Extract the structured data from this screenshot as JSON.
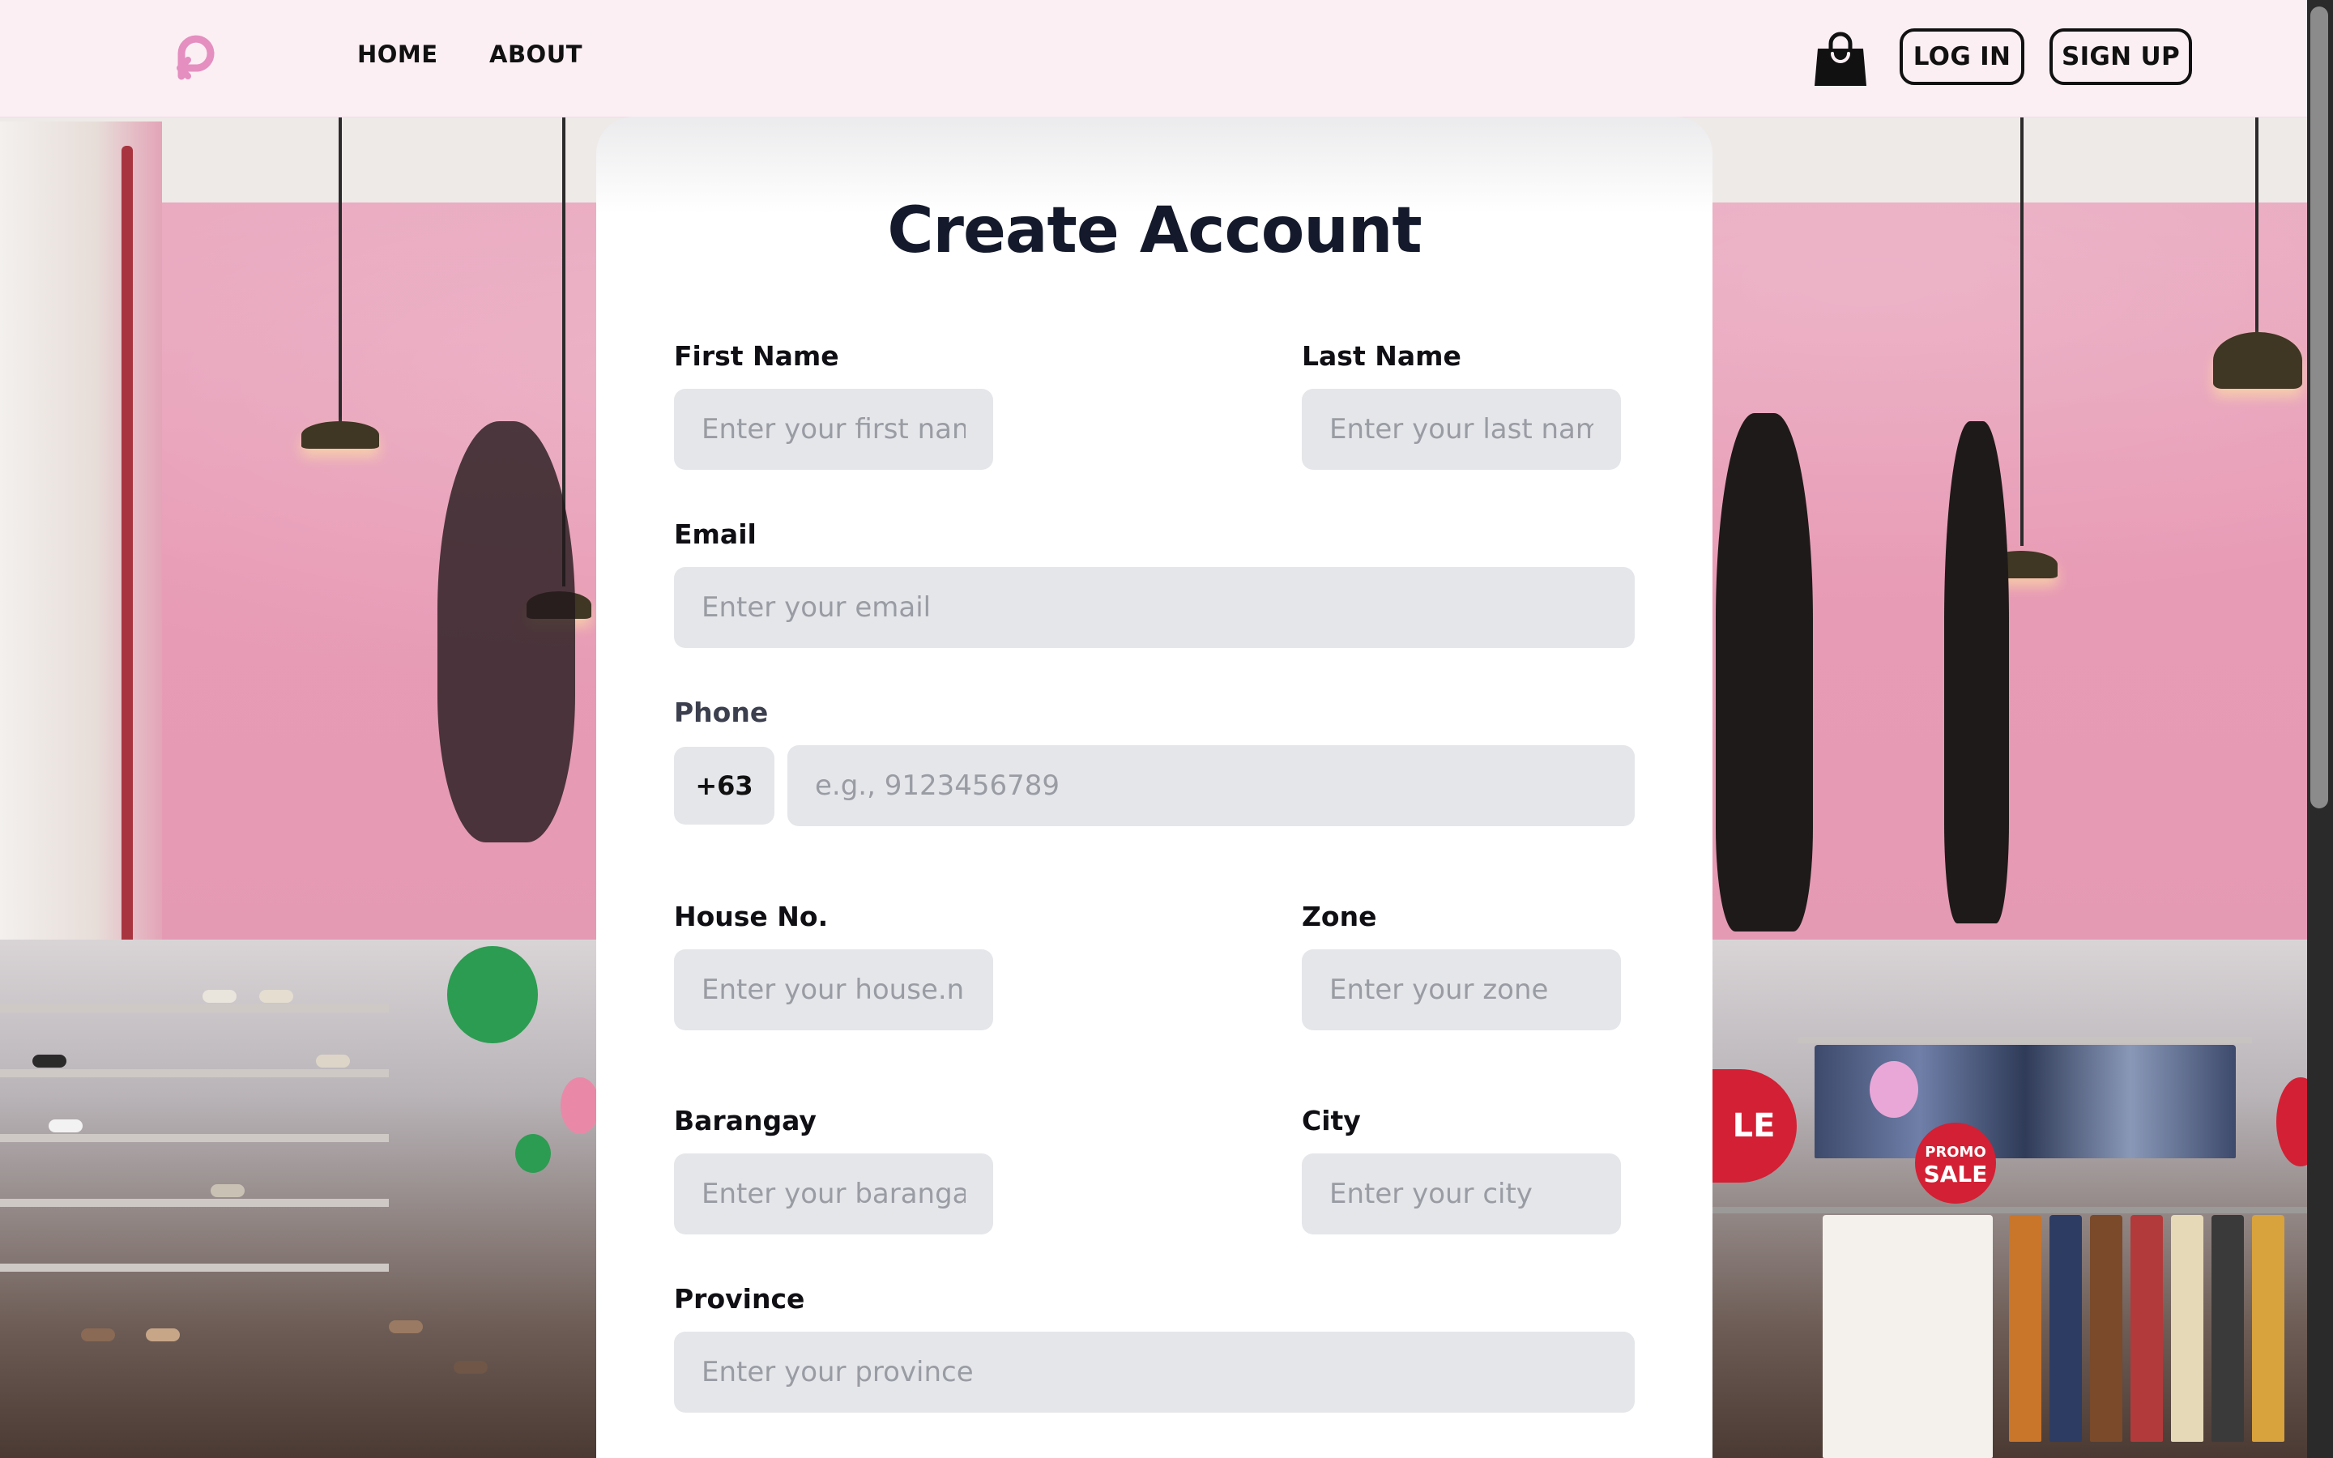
{
  "nav": {
    "home_label": "HOME",
    "about_label": "ABOUT",
    "login_label": "LOG IN",
    "signup_label": "SIGN UP",
    "logo_icon": "logo-icon",
    "cart_icon": "shopping-bag-icon",
    "brand_color": "#e48fc0"
  },
  "form": {
    "title": "Create Account",
    "first_name": {
      "label": "First Name",
      "placeholder": "Enter your first name",
      "value": ""
    },
    "last_name": {
      "label": "Last Name",
      "placeholder": "Enter your last name",
      "value": ""
    },
    "email": {
      "label": "Email",
      "placeholder": "Enter your email",
      "value": ""
    },
    "phone": {
      "label": "Phone",
      "prefix": "+63",
      "placeholder": "e.g., 9123456789",
      "value": ""
    },
    "house_no": {
      "label": "House No.",
      "placeholder": "Enter your house.no",
      "value": ""
    },
    "zone": {
      "label": "Zone",
      "placeholder": "Enter your zone",
      "value": ""
    },
    "barangay": {
      "label": "Barangay",
      "placeholder": "Enter your barangay",
      "value": ""
    },
    "city": {
      "label": "City",
      "placeholder": "Enter your city",
      "value": ""
    },
    "province": {
      "label": "Province",
      "placeholder": "Enter your province",
      "value": ""
    }
  },
  "background": {
    "sale_badge_top": "PROMO",
    "sale_badge_bottom": "SALE",
    "sale_badge_partial": "LE"
  }
}
